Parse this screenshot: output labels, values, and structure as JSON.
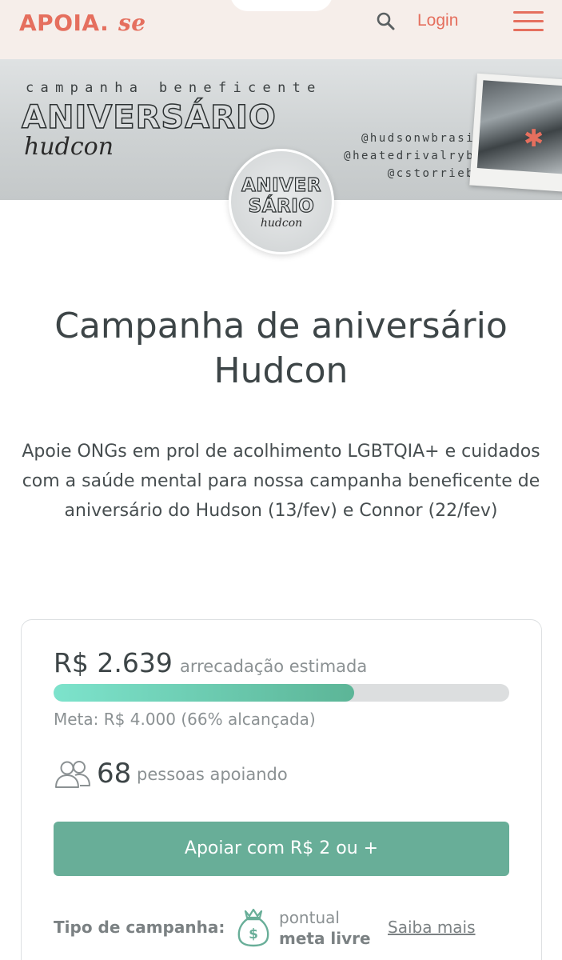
{
  "header": {
    "logo_main": "APOIA.",
    "logo_se": "se",
    "login_label": "Login",
    "icons": {
      "search": "search-icon",
      "menu": "hamburger-menu-icon"
    },
    "colors": {
      "brand": "#e56f5e",
      "background": "#f6eeea"
    }
  },
  "banner": {
    "tagline": "campanha beneficente",
    "title": "ANIVERSÁRIO",
    "script": "hudcon",
    "handles": [
      "@hudsonwbrasil",
      "@heatedrivalrybr",
      "@cstorriebr"
    ],
    "avatar": {
      "line1": "ANIVER",
      "line2": "SÁRIO",
      "script": "hudcon"
    }
  },
  "campaign": {
    "title": "Campanha de aniversário Hudcon",
    "description": "Apoie ONGs em prol de acolhimento LGBTQIA+ e cuidados com a saúde mental para nossa campanha beneficente de aniversário do Hudson (13/fev) e Connor (22/fev)"
  },
  "funding": {
    "amount": "R$ 2.639",
    "amount_label": "arrecadação estimada",
    "progress_fraction": 0.66,
    "goal_text": "Meta: R$ 4.000 (66% alcançada)",
    "supporters_count": "68",
    "supporters_label": "pessoas apoiando",
    "button_label": "Apoiar com R$ 2 ou +",
    "colors": {
      "button": "#68ae98",
      "progress_start": "#7de3cc",
      "progress_end": "#5cb597"
    }
  },
  "campaign_type": {
    "label": "Tipo de campanha:",
    "line1": "pontual",
    "line2": "meta livre",
    "link": "Saiba mais",
    "icon": "money-bag-icon"
  }
}
